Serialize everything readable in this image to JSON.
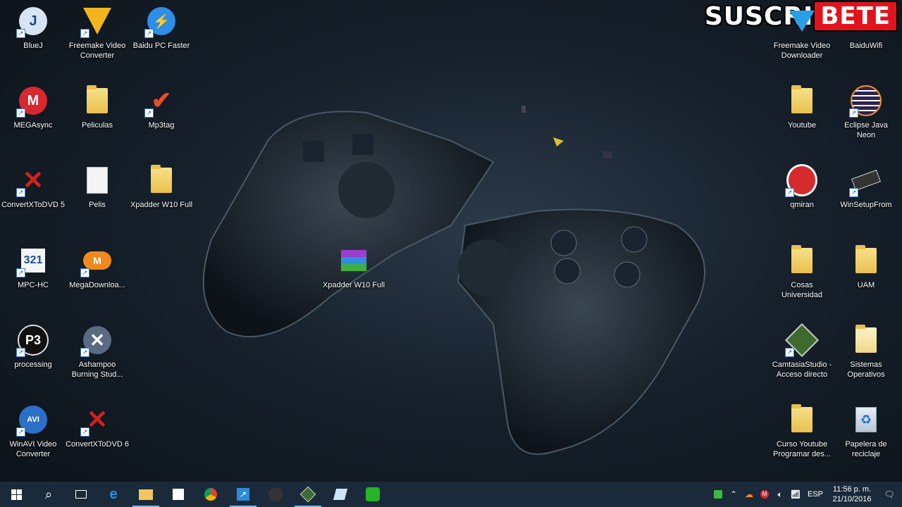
{
  "desktop": {
    "left_icons": [
      {
        "label": "BlueJ",
        "icon": "bluej-icon"
      },
      {
        "label": "Freemake Video Converter",
        "icon": "freemake-icon"
      },
      {
        "label": "Baidu PC Faster",
        "icon": "baidu-icon"
      },
      {
        "label": "MEGAsync",
        "icon": "mega-icon"
      },
      {
        "label": "Peliculas",
        "icon": "folder-icon"
      },
      {
        "label": "Mp3tag",
        "icon": "mp3tag-icon"
      },
      {
        "label": "ConvertXToDVD 5",
        "icon": "convertx-icon"
      },
      {
        "label": "Pelis",
        "icon": "document-icon"
      },
      {
        "label": "Xpadder W10 Full",
        "icon": "folder-icon"
      },
      {
        "label": "MPC-HC",
        "icon": "mpc-icon"
      },
      {
        "label": "MegaDownloa...",
        "icon": "mega-cloud-icon"
      },
      {
        "label": "processing",
        "icon": "processing-icon"
      },
      {
        "label": "Ashampoo Burning Stud...",
        "icon": "ashampoo-icon"
      },
      {
        "label": "WinAVI Video Converter",
        "icon": "winavi-icon"
      },
      {
        "label": "ConvertXToDVD 6",
        "icon": "convertx-icon"
      }
    ],
    "center_icon": {
      "label": "Xpadder W10 Full",
      "icon": "winrar-icon"
    },
    "right_icons": [
      {
        "label": "Freemake Video Downloader",
        "icon": "freemake-icon"
      },
      {
        "label": "BaiduWifi",
        "icon": "wifi-icon"
      },
      {
        "label": "Youtube",
        "icon": "folder-icon"
      },
      {
        "label": "Eclipse Java Neon",
        "icon": "eclipse-icon"
      },
      {
        "label": "qmiran",
        "icon": "record-icon"
      },
      {
        "label": "WinSetupFrom",
        "icon": "usb-icon"
      },
      {
        "label": "Cosas Universidad",
        "icon": "folder-icon"
      },
      {
        "label": "UAM",
        "icon": "folder-icon"
      },
      {
        "label": "CamtasiaStudio - Acceso directo",
        "icon": "camtasia-icon"
      },
      {
        "label": "Sistemas Operativos",
        "icon": "folder-icon"
      },
      {
        "label": "Curso Youtube Programar des...",
        "icon": "folder-icon"
      },
      {
        "label": "Papelera de reciclaje",
        "icon": "recycle-bin-icon"
      }
    ]
  },
  "banner": {
    "left": "SUSCRI",
    "right": "BETE"
  },
  "taskbar": {
    "buttons": [
      "windows-start-icon",
      "search-icon",
      "task-view-icon",
      "edge-icon",
      "file-explorer-icon",
      "store-icon",
      "chrome-icon",
      "shortcut-app-icon",
      "app-10k-icon",
      "camtasia-icon",
      "notes-icon",
      "wifi-app-icon"
    ],
    "tray": {
      "language": "ESP",
      "time": "11:56 p. m.",
      "date": "21/10/2016"
    }
  },
  "colors": {
    "taskbar": "#1b2a3a",
    "accent": "#76b9ed",
    "banner_red": "#e2131c"
  }
}
